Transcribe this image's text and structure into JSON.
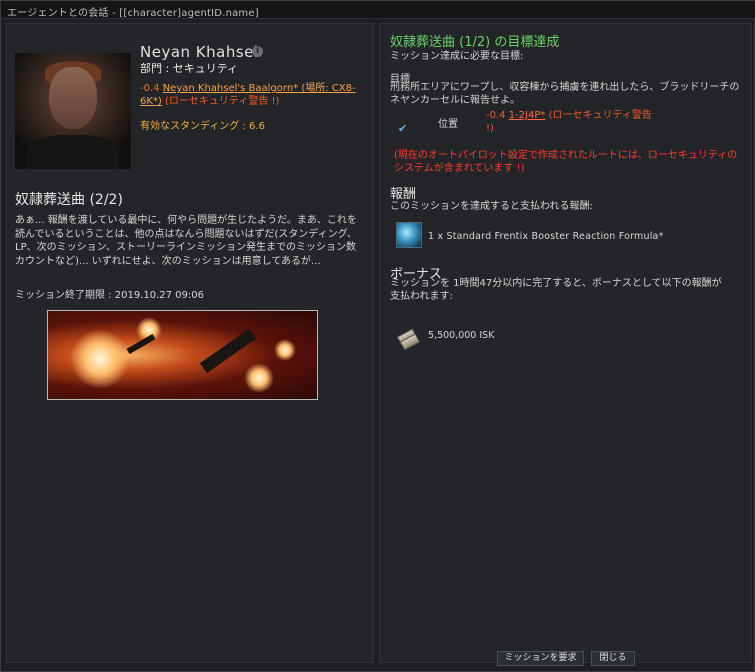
{
  "window": {
    "title": "エージェントとの会話 - [[character]agentID.name]"
  },
  "agent": {
    "name": "Neyan Khahsel",
    "division": "部門 : セキュリティ",
    "location_security": "-0.4",
    "location_link": "Neyan Khahsel's Baalgorn* (場所: CX8-6K*)",
    "location_warning": "(ローセキュリティ警告 !)",
    "standing": "有効なスタンディング : 6.6"
  },
  "mission": {
    "heading": "奴隷葬送曲 (2/2)",
    "text": "あぁ... 報酬を渡している最中に、何やら問題が生じたようだ。まあ、これを読んでいるということは、他の点はなんら問題ないはずだ(スタンディング、LP、次のミッション、ストーリーラインミッション発生までのミッション数カウントなど)... いずれにせよ、次のミッションは用意してあるが...",
    "expiry": "ミッション終了期限 : 2019.10.27 09:06"
  },
  "objectives": {
    "title": "奴隷葬送曲 (1/2)  の目標達成",
    "subtitle": "ミッション達成に必要な目標:",
    "goal_label": "目標",
    "goal_text": "刑務所エリアにワープし、収容棟から捕虜を連れ出したら、ブラッドリーチのネヤンカーセルに報告せよ。",
    "location_label": "位置",
    "location_security": "-0.4",
    "location_link": "1-2J4P*",
    "location_warning": "(ローセキュリティ警告 !)",
    "route_warning": "(現在のオートパイロット設定で作成されたルートには、ローセキュリティのシステムが含まれています !)"
  },
  "rewards": {
    "heading": "報酬",
    "subtitle": "このミッションを達成すると支払われる報酬:",
    "item": "1 x Standard Frentix Booster Reaction Formula*"
  },
  "bonus": {
    "heading": "ボーナス",
    "subtitle": "ミッションを 1時間47分以内に完了すると、ボーナスとして以下の報酬が支払われます:",
    "amount": "5,500,000 ISK"
  },
  "buttons": {
    "request_mission": "ミッションを要求",
    "close": "閉じる"
  },
  "colors": {
    "objective_title": "#6ad26a",
    "low_sec": "#ff5a1f",
    "standing": "#f3b23a",
    "route_warning": "#ff3a2a"
  },
  "icons": {
    "info": "info-icon",
    "check": "check-icon",
    "reward_item": "booster-formula-icon",
    "isk": "isk-icon"
  }
}
